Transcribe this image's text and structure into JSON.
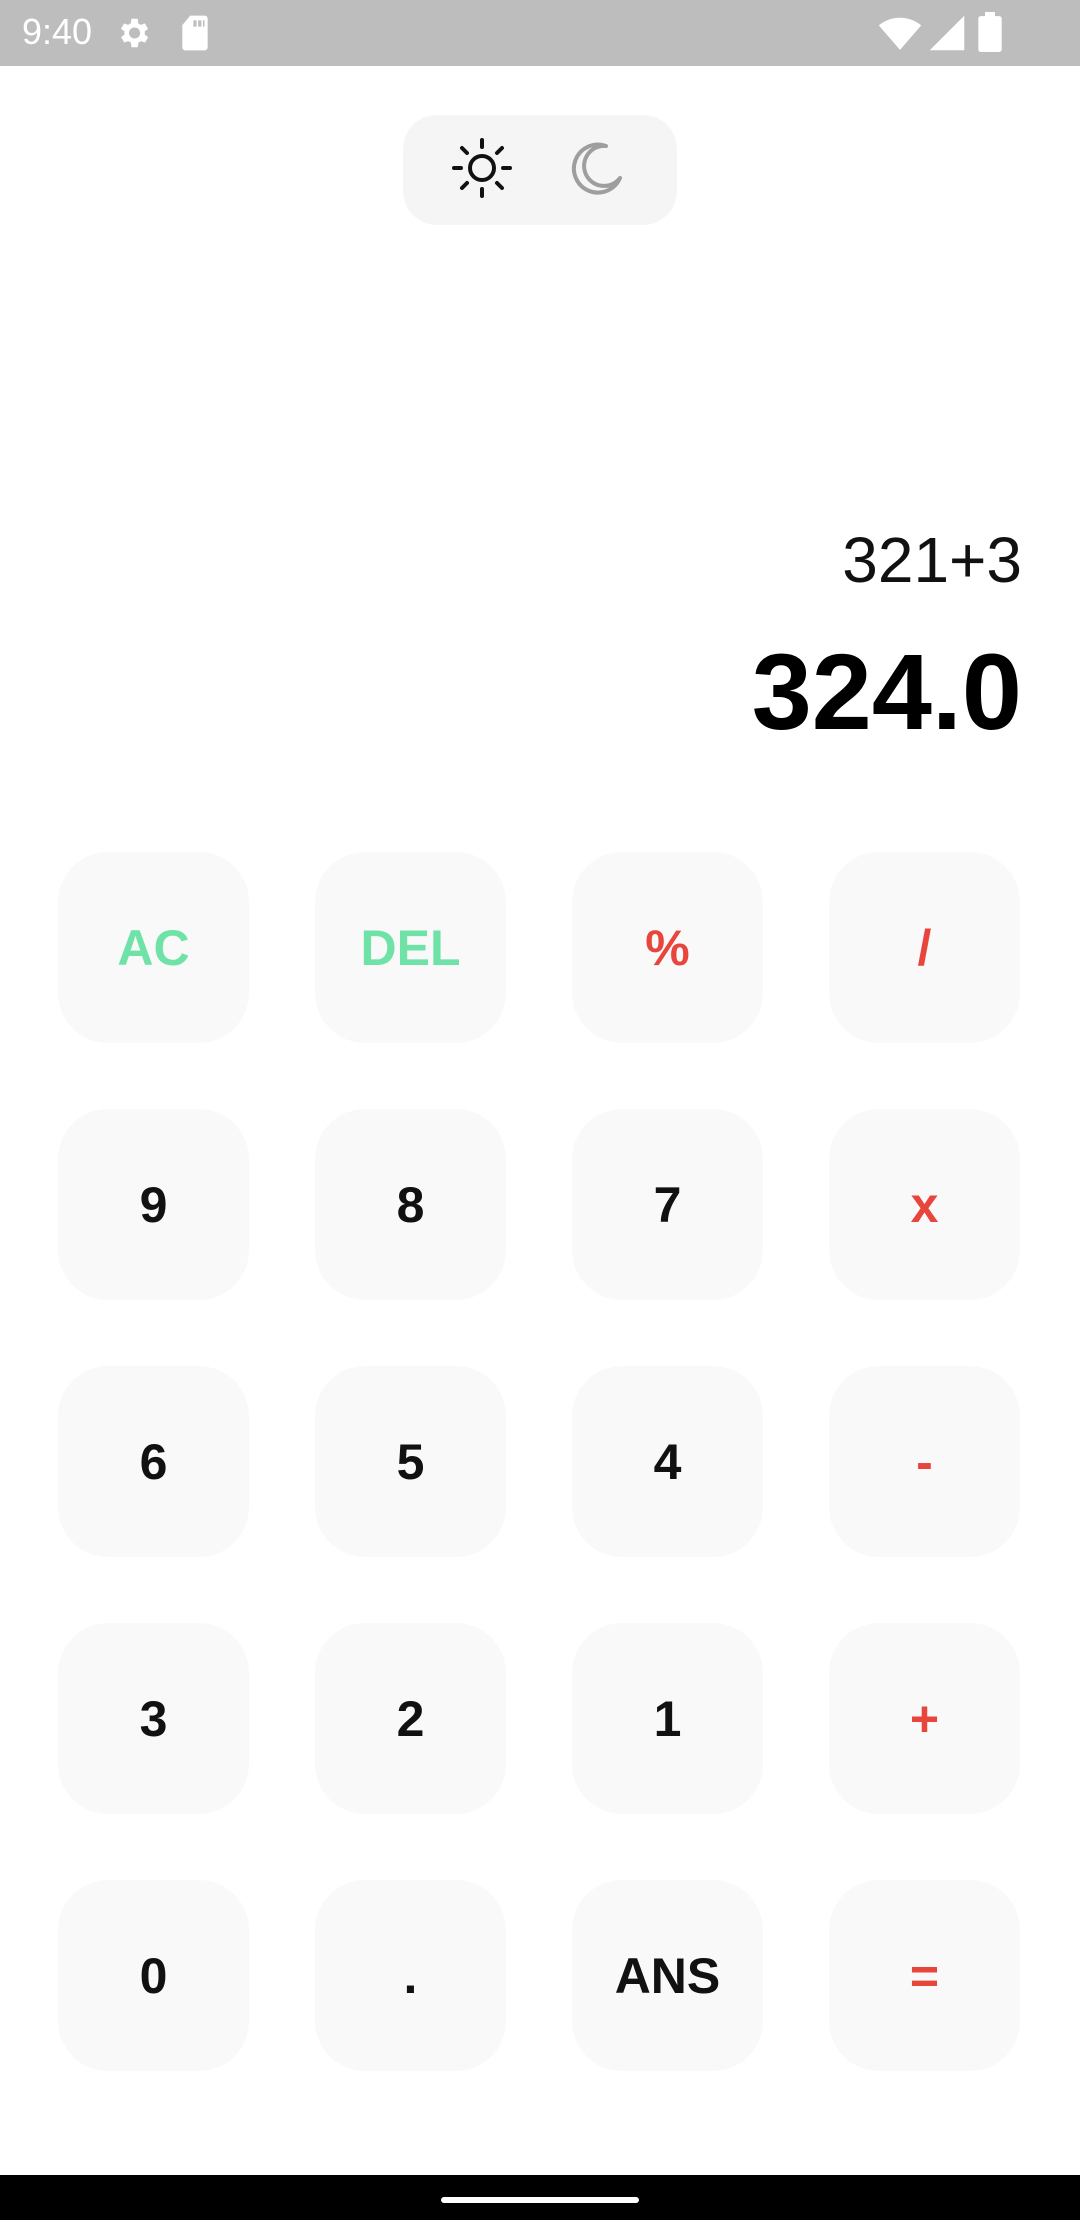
{
  "status_bar": {
    "time": "9:40",
    "icons": [
      "settings-icon",
      "sd-card-icon",
      "wifi-icon",
      "cellular-signal-icon",
      "battery-icon"
    ],
    "background": "#bdbdbd"
  },
  "theme_toggle": {
    "options": [
      "light",
      "dark"
    ],
    "selected": "light",
    "icons": [
      "sun-icon",
      "moon-icon"
    ]
  },
  "display": {
    "expression": "321+3",
    "result": "324.0"
  },
  "keypad": {
    "rows": [
      [
        {
          "label": "AC",
          "kind": "fn"
        },
        {
          "label": "DEL",
          "kind": "fn"
        },
        {
          "label": "%",
          "kind": "op"
        },
        {
          "label": "/",
          "kind": "op"
        }
      ],
      [
        {
          "label": "9",
          "kind": "num"
        },
        {
          "label": "8",
          "kind": "num"
        },
        {
          "label": "7",
          "kind": "num"
        },
        {
          "label": "x",
          "kind": "op"
        }
      ],
      [
        {
          "label": "6",
          "kind": "num"
        },
        {
          "label": "5",
          "kind": "num"
        },
        {
          "label": "4",
          "kind": "num"
        },
        {
          "label": "-",
          "kind": "op"
        }
      ],
      [
        {
          "label": "3",
          "kind": "num"
        },
        {
          "label": "2",
          "kind": "num"
        },
        {
          "label": "1",
          "kind": "num"
        },
        {
          "label": "+",
          "kind": "op"
        }
      ],
      [
        {
          "label": "0",
          "kind": "num"
        },
        {
          "label": ".",
          "kind": "num"
        },
        {
          "label": "ANS",
          "kind": "num"
        },
        {
          "label": "=",
          "kind": "op"
        }
      ]
    ]
  },
  "colors": {
    "function_key": "#6fe3a7",
    "operator_key": "#e8453c",
    "number_key": "#111111",
    "key_background": "#f9f9f9"
  }
}
